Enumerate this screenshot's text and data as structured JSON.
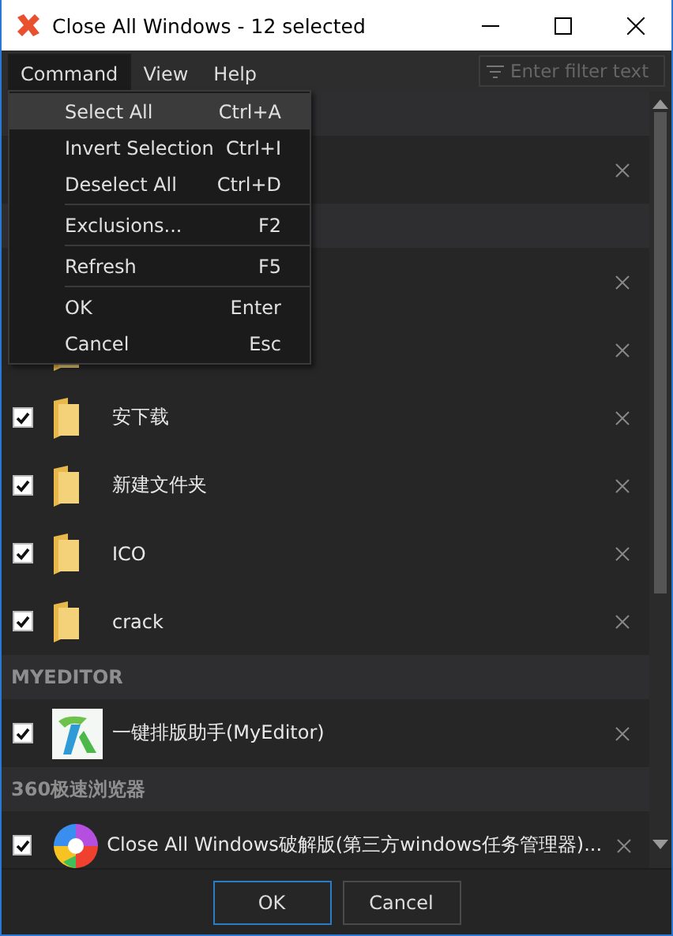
{
  "window": {
    "title": "Close All Windows - 12 selected"
  },
  "menu_bar": [
    {
      "label": "Command",
      "selected": true
    },
    {
      "label": "View",
      "selected": false
    },
    {
      "label": "Help",
      "selected": false
    }
  ],
  "filter": {
    "placeholder": "Enter filter text"
  },
  "groups": [
    {
      "items": [
        {
          "kind": "hidden"
        }
      ]
    },
    {
      "items": [
        {
          "kind": "hidden"
        },
        {
          "kind": "folder"
        },
        {
          "kind": "folder",
          "checked": true,
          "name": "安下载"
        },
        {
          "kind": "folder",
          "checked": true,
          "name": "新建文件夹"
        },
        {
          "kind": "folder",
          "checked": true,
          "name": "ICO"
        },
        {
          "kind": "folder",
          "checked": true,
          "name": "crack"
        }
      ]
    },
    {
      "title": "MYEDITOR",
      "items": [
        {
          "kind": "editor",
          "checked": true,
          "name": "一键排版助手(MyEditor)"
        }
      ]
    },
    {
      "title": "360极速浏览器",
      "items": [
        {
          "kind": "browser",
          "checked": true,
          "name": "Close All Windows破解版(第三方windows任务管理器)..."
        }
      ]
    }
  ],
  "dropdown": [
    {
      "kind": "item",
      "label": "Select All",
      "shortcut": "Ctrl+A",
      "selected": true
    },
    {
      "kind": "item",
      "label": "Invert Selection",
      "shortcut": "Ctrl+I",
      "selected": false
    },
    {
      "kind": "item",
      "label": "Deselect All",
      "shortcut": "Ctrl+D",
      "selected": false
    },
    {
      "kind": "separator"
    },
    {
      "kind": "item",
      "label": "Exclusions...",
      "shortcut": "F2",
      "selected": false
    },
    {
      "kind": "separator"
    },
    {
      "kind": "item",
      "label": "Refresh",
      "shortcut": "F5",
      "selected": false
    },
    {
      "kind": "separator"
    },
    {
      "kind": "item",
      "label": "OK",
      "shortcut": "Enter",
      "selected": false
    },
    {
      "kind": "item",
      "label": "Cancel",
      "shortcut": "Esc",
      "selected": false
    }
  ],
  "buttons": [
    {
      "label": "OK",
      "selected": true
    },
    {
      "label": "Cancel",
      "selected": false
    }
  ]
}
